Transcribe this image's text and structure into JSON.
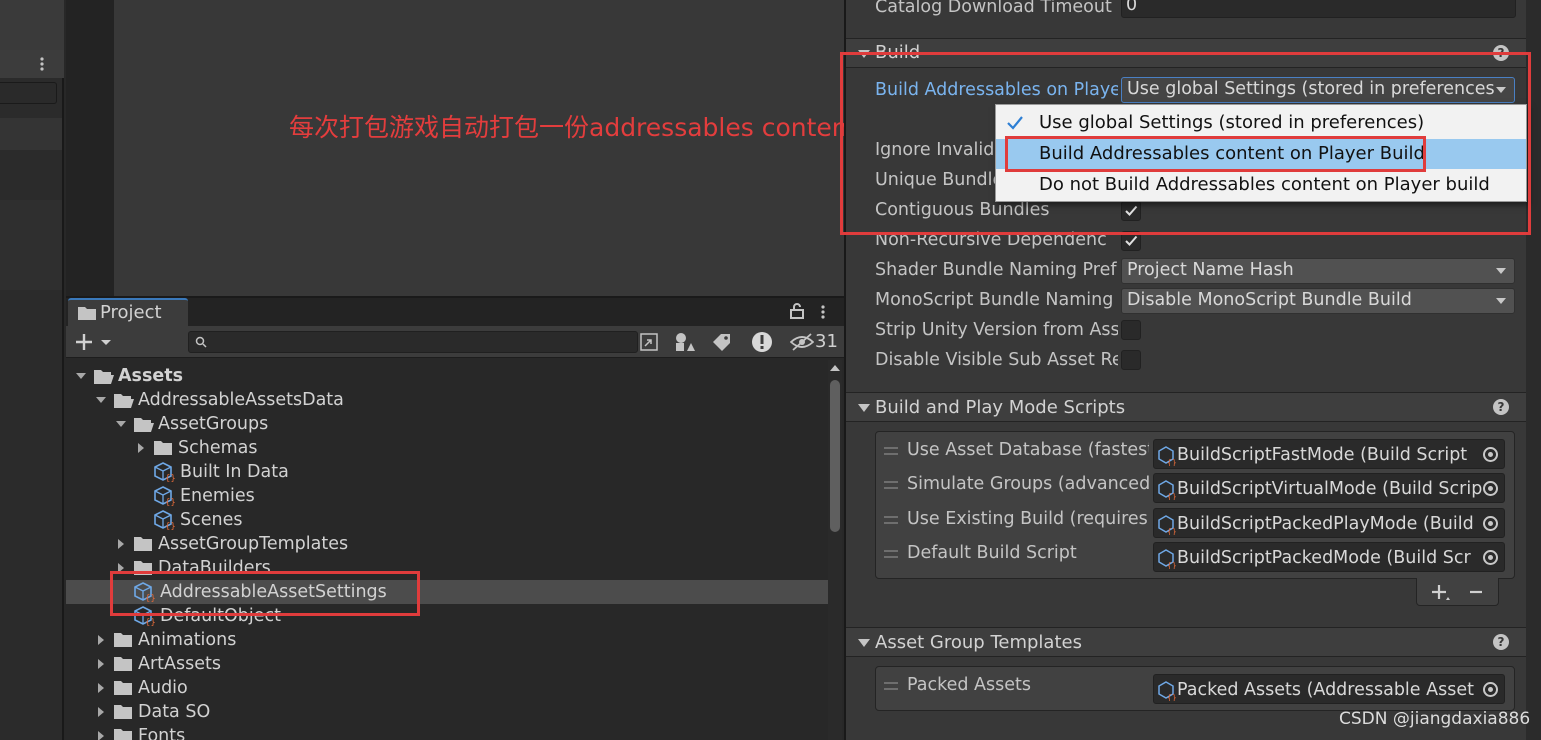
{
  "annotation": "每次打包游戏自动打包一份addressables content",
  "project": {
    "tab_label": "Project",
    "hidden_count": "31",
    "tree": [
      {
        "label": "Assets",
        "type": "folder-open",
        "expanded": true,
        "bold": true
      },
      {
        "label": "AddressableAssetsData",
        "type": "folder-open",
        "expanded": true
      },
      {
        "label": "AssetGroups",
        "type": "folder-open",
        "expanded": true
      },
      {
        "label": "Schemas",
        "type": "folder",
        "expanded": false
      },
      {
        "label": "Built In Data",
        "type": "asset"
      },
      {
        "label": "Enemies",
        "type": "asset"
      },
      {
        "label": "Scenes",
        "type": "asset"
      },
      {
        "label": "AssetGroupTemplates",
        "type": "folder",
        "expanded": false
      },
      {
        "label": "DataBuilders",
        "type": "folder",
        "expanded": false
      },
      {
        "label": "AddressableAssetSettings",
        "type": "asset",
        "selected": true
      },
      {
        "label": "DefaultObject",
        "type": "asset"
      },
      {
        "label": "Animations",
        "type": "folder",
        "expanded": false
      },
      {
        "label": "ArtAssets",
        "type": "folder",
        "expanded": false
      },
      {
        "label": "Audio",
        "type": "folder",
        "expanded": false
      },
      {
        "label": "Data SO",
        "type": "folder",
        "expanded": false
      },
      {
        "label": "Fonts",
        "type": "folder",
        "expanded": false
      }
    ]
  },
  "inspector": {
    "catalog_timeout_label": "Catalog Download Timeout",
    "catalog_timeout_value": "0",
    "build_section_title": "Build",
    "build_addressables_label": "Build Addressables on Playe",
    "build_addressables_value": "Use global Settings (stored in preferences",
    "ignore_invalid_label": "Ignore Invalid",
    "unique_bundle_label": "Unique Bundle",
    "contiguous_label": "Contiguous Bundles",
    "non_recursive_label": "Non-Recursive Dependenc",
    "shader_naming_label": "Shader Bundle Naming Pref",
    "shader_naming_value": "Project Name Hash",
    "monoscript_label": "MonoScript Bundle Naming",
    "monoscript_value": "Disable MonoScript Bundle Build",
    "strip_unity_label": "Strip Unity Version from Ass",
    "disable_visible_label": "Disable Visible Sub Asset Re",
    "scripts_section_title": "Build and Play Mode Scripts",
    "scripts": [
      {
        "label": "Use Asset Database (fastest",
        "value": "BuildScriptFastMode (Build Script"
      },
      {
        "label": "Simulate Groups (advanced",
        "value": "BuildScriptVirtualMode (Build Scrip"
      },
      {
        "label": "Use Existing Build (requires",
        "value": "BuildScriptPackedPlayMode (Build"
      },
      {
        "label": "Default Build Script",
        "value": "BuildScriptPackedMode (Build Scr"
      }
    ],
    "templates_section_title": "Asset Group Templates",
    "template_label": "Packed Assets",
    "template_value": "Packed Assets (Addressable Asset"
  },
  "popup": {
    "options": [
      {
        "label": "Use global Settings (stored in preferences)",
        "checked": true
      },
      {
        "label": "Build Addressables content on Player Build",
        "highlighted": true
      },
      {
        "label": "Do not Build Addressables content on Player build"
      }
    ]
  },
  "watermark": "CSDN @jiangdaxia886",
  "colors": {
    "accent_red": "#e03c3c",
    "highlight": "#99c9ef",
    "label_blue": "#7ab4ef"
  }
}
